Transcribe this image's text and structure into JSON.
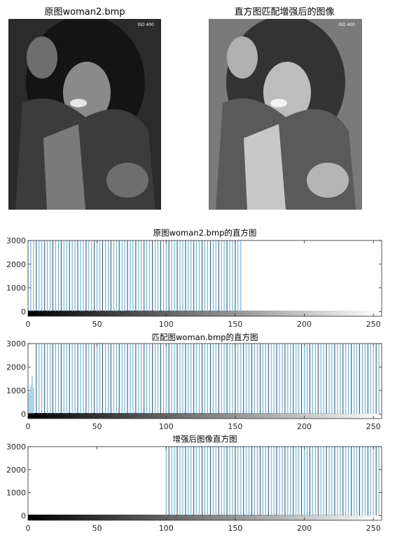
{
  "images": {
    "original_title": "原图woman2.bmp",
    "enhanced_title": "直方图匹配增强后的图像",
    "iso_stamp": "ISO 400"
  },
  "chart_data": [
    {
      "type": "bar",
      "title": "原图woman2.bmp的直方图",
      "xlim": [
        0,
        255
      ],
      "ylim": [
        -200,
        3000
      ],
      "xticks": [
        0,
        50,
        100,
        150,
        200,
        250
      ],
      "yticks": [
        0,
        1000,
        2000,
        3000
      ],
      "occupied_range": [
        2,
        155
      ],
      "bar_spacing": 2,
      "values_note_clip": 3000,
      "grayscale_colorbar": true
    },
    {
      "type": "bar",
      "title": "匹配图woman.bmp的直方图",
      "xlim": [
        0,
        255
      ],
      "ylim": [
        -200,
        3000
      ],
      "xticks": [
        0,
        50,
        100,
        150,
        200,
        250
      ],
      "yticks": [
        0,
        1000,
        2000,
        3000
      ],
      "occupied_range": [
        6,
        255
      ],
      "bar_spacing": 2,
      "low_bins": [
        {
          "x": 1,
          "y": 900
        },
        {
          "x": 2,
          "y": 1200
        },
        {
          "x": 3,
          "y": 1600
        },
        {
          "x": 4,
          "y": 1100
        }
      ],
      "grayscale_colorbar": true
    },
    {
      "type": "bar",
      "title": "增强后图像直方图",
      "xlim": [
        0,
        255
      ],
      "ylim": [
        -200,
        3000
      ],
      "xticks": [
        0,
        50,
        100,
        150,
        200,
        250
      ],
      "yticks": [
        0,
        1000,
        2000,
        3000
      ],
      "occupied_range": [
        100,
        255
      ],
      "bar_spacing": 2,
      "grayscale_colorbar": true
    }
  ],
  "colors": {
    "bar": "#5aa9dc",
    "bar_dark": "#1e4d6b",
    "axis": "#262626"
  }
}
